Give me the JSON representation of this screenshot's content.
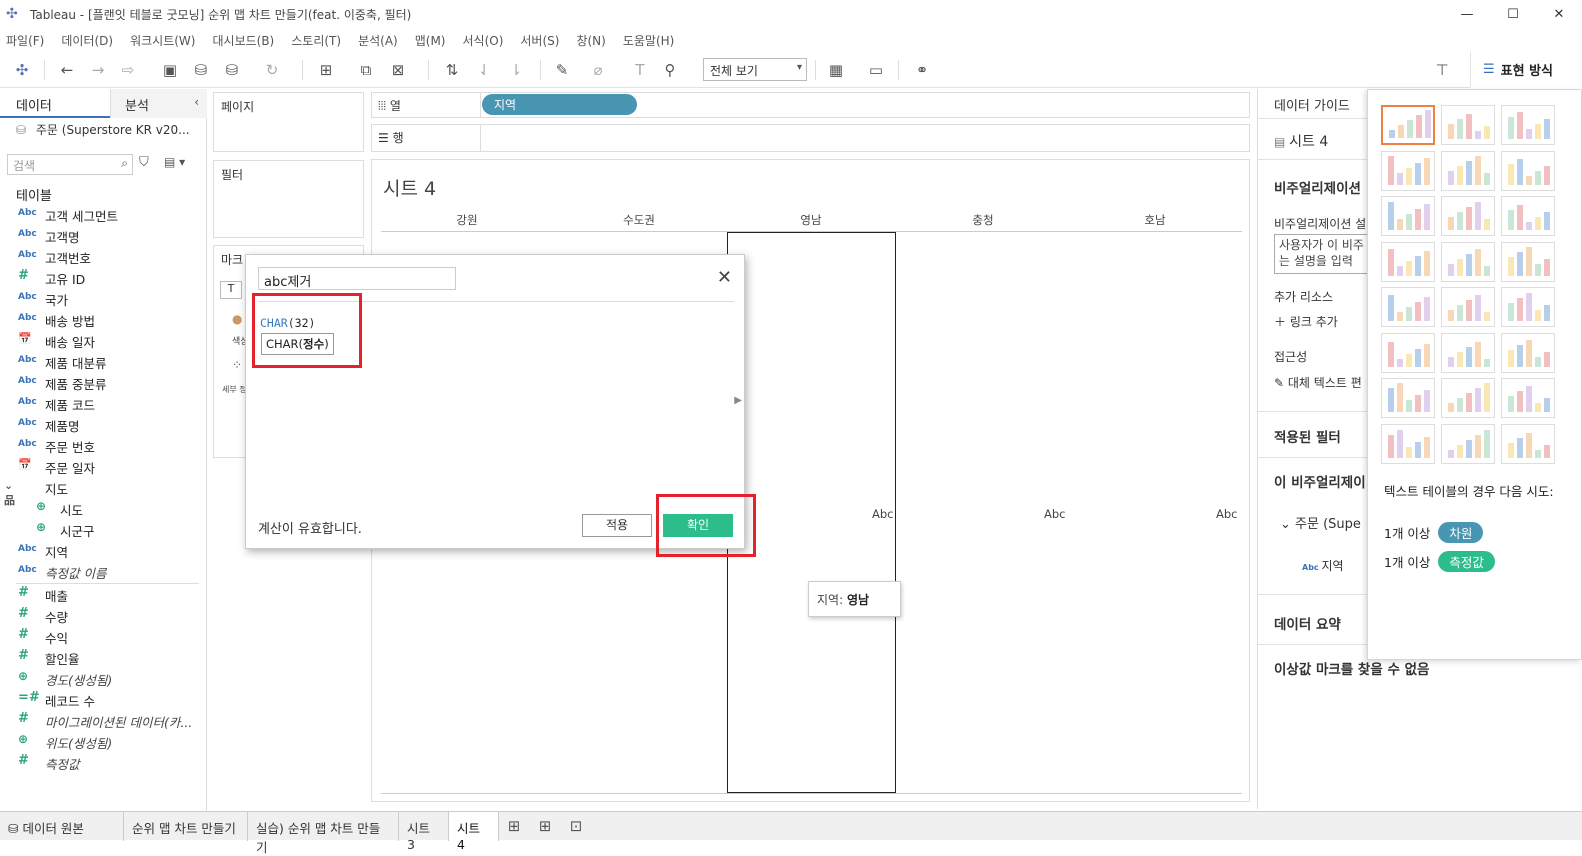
{
  "window": {
    "title": "Tableau - [플랜잇 테블로 굿모닝] 순위 맵 차트 만들기(feat. 이중축, 필터)",
    "controls": [
      "—",
      "☐",
      "✕"
    ]
  },
  "menu": [
    "파일(F)",
    "데이터(D)",
    "워크시트(W)",
    "대시보드(B)",
    "스토리(T)",
    "분석(A)",
    "맵(M)",
    "서식(O)",
    "서버(S)",
    "창(N)",
    "도움말(H)"
  ],
  "toolbar": {
    "fit_value": "전체 보기",
    "showme_label": "표현 방식"
  },
  "datapane": {
    "tab_data": "데이터",
    "tab_analysis": "분석",
    "datasource": "주문 (Superstore KR v20...",
    "search_placeholder": "검색",
    "tables_header": "테이블",
    "fields": [
      {
        "type": "Abc",
        "name": "고객 세그먼트"
      },
      {
        "type": "Abc",
        "name": "고객명"
      },
      {
        "type": "Abc",
        "name": "고객번호"
      },
      {
        "type": "#",
        "name": "고유 ID"
      },
      {
        "type": "Abc",
        "name": "국가"
      },
      {
        "type": "Abc",
        "name": "배송 방법"
      },
      {
        "type": "📅",
        "name": "배송 일자"
      },
      {
        "type": "Abc",
        "name": "제품 대분류"
      },
      {
        "type": "Abc",
        "name": "제품 중분류"
      },
      {
        "type": "Abc",
        "name": "제품 코드"
      },
      {
        "type": "Abc",
        "name": "제품명"
      },
      {
        "type": "Abc",
        "name": "주문 번호"
      },
      {
        "type": "📅",
        "name": "주문 일자"
      },
      {
        "type": "⌄ 品",
        "name": "지도"
      },
      {
        "type": "⊕",
        "name": "시도"
      },
      {
        "type": "⊕",
        "name": "시군구"
      },
      {
        "type": "Abc",
        "name": "지역"
      },
      {
        "type": "Abc",
        "name": "측정값 이름"
      },
      {
        "type": "#",
        "name": "매출"
      },
      {
        "type": "#",
        "name": "수량"
      },
      {
        "type": "#",
        "name": "수익"
      },
      {
        "type": "#",
        "name": "할인율"
      },
      {
        "type": "⊕",
        "name": "경도(생성됨)"
      },
      {
        "type": "=#",
        "name": "레코드 수"
      },
      {
        "type": "#",
        "name": "마이그레이션된 데이터(카..."
      },
      {
        "type": "⊕",
        "name": "위도(생성됨)"
      },
      {
        "type": "#",
        "name": "측정값"
      }
    ]
  },
  "cards": {
    "pages": "페이지",
    "filters": "필터",
    "marks": "마크",
    "marks_color": "색상",
    "marks_detail": "세부 정보"
  },
  "shelves": {
    "columns_label": "열",
    "rows_label": "행",
    "columns_pill": "지역"
  },
  "sheet": {
    "title": "시트 4",
    "columns": [
      "강원",
      "수도권",
      "영남",
      "충청",
      "호남"
    ],
    "abc_labels": [
      "Abc",
      "Abc",
      "Abc"
    ],
    "tooltip_key": "지역:",
    "tooltip_value": "영남"
  },
  "calc": {
    "name": "abc제거",
    "formula_fn": "CHAR",
    "formula_open": "(",
    "formula_arg": "32",
    "formula_close": ")",
    "hint_fn": "CHAR(",
    "hint_arg": "정수",
    "hint_close": ")",
    "valid_text": "계산이 유효합니다.",
    "apply_label": "적용",
    "ok_label": "확인"
  },
  "dataguide": {
    "header": "데이터 가이드",
    "sheet_name": "시트 4",
    "viz_header": "비주얼리제이션",
    "viz_desc_label": "비주얼리제이션 설",
    "viz_desc_placeholder": "사용자가 이 비주 되는 설명을 입력",
    "resources_label": "추가 리소스",
    "add_link": "링크 추가",
    "accessibility": "접근성",
    "alt_text": "대체 텍스트 편",
    "applied_filters": "적용된 필터",
    "this_viz": "이 비주얼리제이",
    "source_name": "주문 (Supe",
    "source_field": "지역",
    "data_summary": "데이터 요약",
    "outliers": "이상값 마크를 찾을 수 없음"
  },
  "showme": {
    "hint": "텍스트 테이블의 경우 다음 시도:",
    "row1_prefix": "1개 이상",
    "row1_pill": "차원",
    "row2_prefix": "1개 이상",
    "row2_pill": "측정값",
    "dimension_color": "#4996b2",
    "measure_color": "#2dbd8a"
  },
  "statusbar": {
    "tabs": [
      "데이터 원본",
      "순위 맵 차트 만들기",
      "실습) 순위 맵 차트 만들기",
      "시트 3",
      "시트 4"
    ],
    "active_tab": "시트 4"
  }
}
